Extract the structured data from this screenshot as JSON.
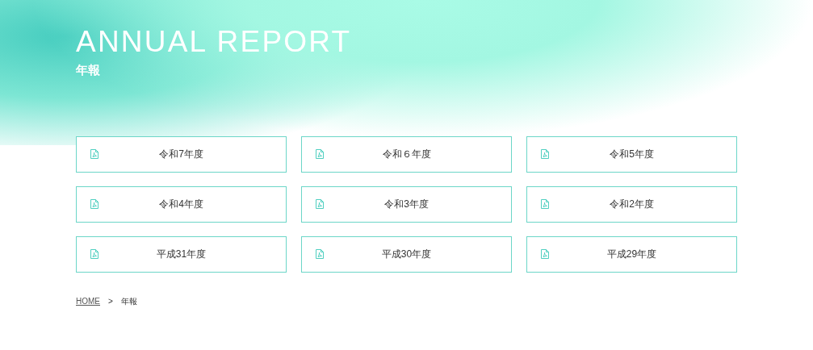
{
  "header": {
    "title": "ANNUAL REPORT",
    "subtitle": "年報"
  },
  "reports": [
    {
      "label": "令和7年度"
    },
    {
      "label": "令和６年度"
    },
    {
      "label": "令和5年度"
    },
    {
      "label": "令和4年度"
    },
    {
      "label": "令和3年度"
    },
    {
      "label": "令和2年度"
    },
    {
      "label": "平成31年度"
    },
    {
      "label": "平成30年度"
    },
    {
      "label": "平成29年度"
    }
  ],
  "breadcrumb": {
    "home": "HOME",
    "separator": ">",
    "current": "年報"
  }
}
